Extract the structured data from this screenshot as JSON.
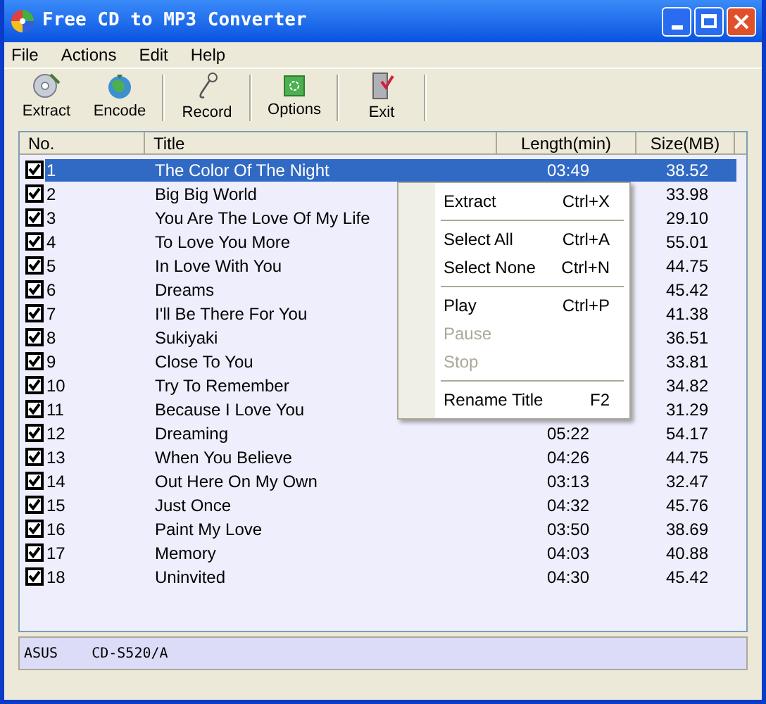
{
  "window": {
    "title": "Free CD to MP3 Converter"
  },
  "menu": [
    "File",
    "Actions",
    "Edit",
    "Help"
  ],
  "toolbar": [
    {
      "kind": "extract",
      "label": "Extract"
    },
    {
      "kind": "encode",
      "label": "Encode"
    },
    {
      "kind": "record",
      "label": "Record"
    },
    {
      "kind": "options",
      "label": "Options"
    },
    {
      "kind": "exit",
      "label": "Exit"
    }
  ],
  "table": {
    "columns": [
      "No.",
      "Title",
      "Length(min)",
      "Size(MB)"
    ],
    "rows": [
      {
        "no": "1",
        "title": "The Color Of The Night",
        "length": "03:49",
        "size": "38.52",
        "checked": true,
        "selected": true
      },
      {
        "no": "2",
        "title": "Big Big World",
        "size": "33.98",
        "checked": true,
        "selected": false
      },
      {
        "no": "3",
        "title": "You Are The Love Of My Life",
        "size": "29.10",
        "checked": true,
        "selected": false
      },
      {
        "no": "4",
        "title": "To Love You More",
        "size": "55.01",
        "checked": true,
        "selected": false
      },
      {
        "no": "5",
        "title": "In Love With You",
        "size": "44.75",
        "checked": true,
        "selected": false
      },
      {
        "no": "6",
        "title": "Dreams",
        "size": "45.42",
        "checked": true,
        "selected": false
      },
      {
        "no": "7",
        "title": "I'll Be There For You",
        "size": "41.38",
        "checked": true,
        "selected": false
      },
      {
        "no": "8",
        "title": "Sukiyaki",
        "size": "36.51",
        "checked": true,
        "selected": false
      },
      {
        "no": "9",
        "title": "Close To You",
        "size": "33.81",
        "checked": true,
        "selected": false
      },
      {
        "no": "10",
        "title": "Try To Remember",
        "size": "34.82",
        "checked": true,
        "selected": false
      },
      {
        "no": "11",
        "title": "Because I Love You",
        "size": "31.29",
        "checked": true,
        "selected": false
      },
      {
        "no": "12",
        "title": "Dreaming",
        "length": "05:22",
        "size": "54.17",
        "checked": true,
        "selected": false
      },
      {
        "no": "13",
        "title": "When You Believe",
        "length": "04:26",
        "size": "44.75",
        "checked": true,
        "selected": false
      },
      {
        "no": "14",
        "title": "Out Here On My Own",
        "length": "03:13",
        "size": "32.47",
        "checked": true,
        "selected": false
      },
      {
        "no": "15",
        "title": "Just Once",
        "length": "04:32",
        "size": "45.76",
        "checked": true,
        "selected": false
      },
      {
        "no": "16",
        "title": "Paint My Love",
        "length": "03:50",
        "size": "38.69",
        "checked": true,
        "selected": false
      },
      {
        "no": "17",
        "title": "Memory",
        "length": "04:03",
        "size": "40.88",
        "checked": true,
        "selected": false
      },
      {
        "no": "18",
        "title": "Uninvited",
        "length": "04:30",
        "size": "45.42",
        "checked": true,
        "selected": false
      }
    ]
  },
  "context_menu": [
    {
      "kind": "item",
      "label": "Extract",
      "shortcut": "Ctrl+X",
      "disabled": false
    },
    {
      "kind": "separator"
    },
    {
      "kind": "item",
      "label": "Select All",
      "shortcut": "Ctrl+A",
      "disabled": false
    },
    {
      "kind": "item",
      "label": "Select None",
      "shortcut": "Ctrl+N",
      "disabled": false
    },
    {
      "kind": "separator"
    },
    {
      "kind": "item",
      "label": "Play",
      "shortcut": "Ctrl+P",
      "disabled": false
    },
    {
      "kind": "item",
      "label": "Pause",
      "disabled": true
    },
    {
      "kind": "item",
      "label": "Stop",
      "disabled": true
    },
    {
      "kind": "separator"
    },
    {
      "kind": "item",
      "label": "Rename Title",
      "shortcut": "F2",
      "disabled": false
    }
  ],
  "status_bar": [
    "ASUS",
    "CD-S520/A"
  ]
}
